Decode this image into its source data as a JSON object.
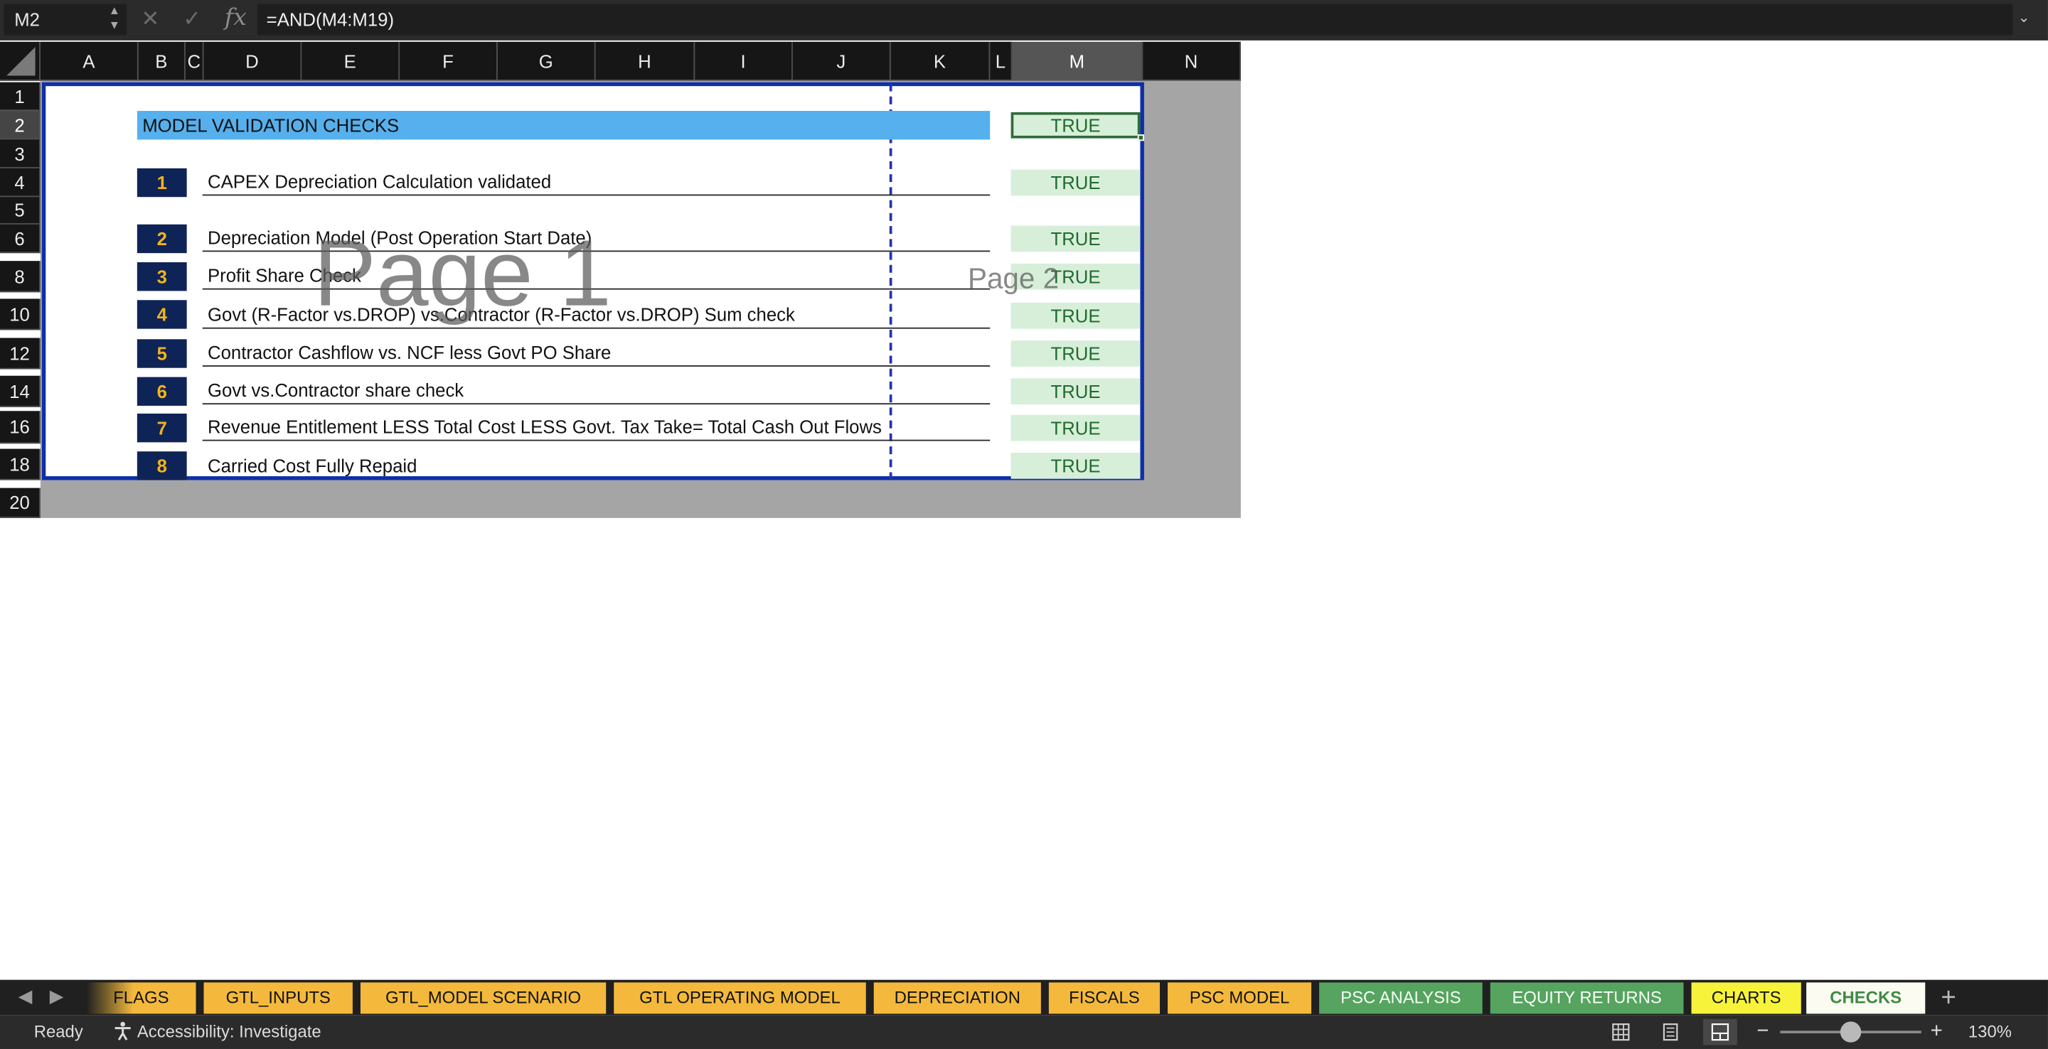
{
  "formula_bar": {
    "name_box": "M2",
    "spin_up": "▲",
    "spin_down": "▼",
    "cancel_glyph": "✕",
    "enter_glyph": "✓",
    "fx_label": "fx",
    "formula": "=AND(M4:M19)",
    "expand_glyph": "⌄"
  },
  "columns": [
    "A",
    "B",
    "C",
    "D",
    "E",
    "F",
    "G",
    "H",
    "I",
    "J",
    "K",
    "L",
    "M",
    "N"
  ],
  "selected_column": "M",
  "rows": [
    "1",
    "2",
    "3",
    "4",
    "5",
    "6",
    "8",
    "10",
    "12",
    "14",
    "16",
    "18",
    "20"
  ],
  "selected_row": "2",
  "sheet": {
    "title": "MODEL VALIDATION  CHECKS",
    "summary_value": "TRUE",
    "checks": [
      {
        "num": "1",
        "label": "CAPEX Depreciation Calculation validated",
        "result": "TRUE"
      },
      {
        "num": "2",
        "label": "Depreciation Model (Post Operation Start Date)",
        "result": "TRUE"
      },
      {
        "num": "3",
        "label": "Profit Share Check",
        "result": "TRUE"
      },
      {
        "num": "4",
        "label": "Govt (R-Factor vs.DROP) vs.Contractor  (R-Factor vs.DROP) Sum check",
        "result": "TRUE"
      },
      {
        "num": "5",
        "label": "Contractor Cashflow vs. NCF less Govt PO  Share",
        "result": "TRUE"
      },
      {
        "num": "6",
        "label": "Govt vs.Contractor share check",
        "result": "TRUE"
      },
      {
        "num": "7",
        "label": "Revenue Entitlement LESS Total Cost LESS Govt. Tax Take= Total Cash Out Flows",
        "result": "TRUE"
      },
      {
        "num": "8",
        "label": "Carried Cost Fully Repaid",
        "result": "TRUE"
      }
    ],
    "page1_watermark": "Page 1",
    "page2_watermark": "Page 2"
  },
  "tabs": [
    {
      "label": "FLAGS",
      "style": "flags"
    },
    {
      "label": "GTL_INPUTS",
      "style": "orange"
    },
    {
      "label": "GTL_MODEL SCENARIO",
      "style": "orange"
    },
    {
      "label": "GTL OPERATING MODEL",
      "style": "orange"
    },
    {
      "label": "DEPRECIATION",
      "style": "orange"
    },
    {
      "label": "FISCALS",
      "style": "orange"
    },
    {
      "label": "PSC MODEL",
      "style": "orange"
    },
    {
      "label": "PSC ANALYSIS",
      "style": "green"
    },
    {
      "label": "EQUITY RETURNS",
      "style": "green"
    },
    {
      "label": "CHARTS",
      "style": "yellow"
    },
    {
      "label": "CHECKS",
      "style": "active"
    }
  ],
  "tab_nav": {
    "prev": "◀",
    "next": "▶",
    "add": "+"
  },
  "status": {
    "ready": "Ready",
    "accessibility": "Accessibility: Investigate",
    "zoom": "130%",
    "zoom_minus": "−",
    "zoom_plus": "+",
    "zoom_level": 0.5
  },
  "colors": {
    "title_band": "#56b0ed",
    "number_box": "#0f2456",
    "number_text": "#f3b41b",
    "true_fill": "#d7efd9",
    "true_text": "#1f6b2e",
    "page_border": "#0f2fa8",
    "tab_orange": "#f4b93c",
    "tab_green": "#56a45f",
    "tab_yellow": "#f7f33a"
  }
}
